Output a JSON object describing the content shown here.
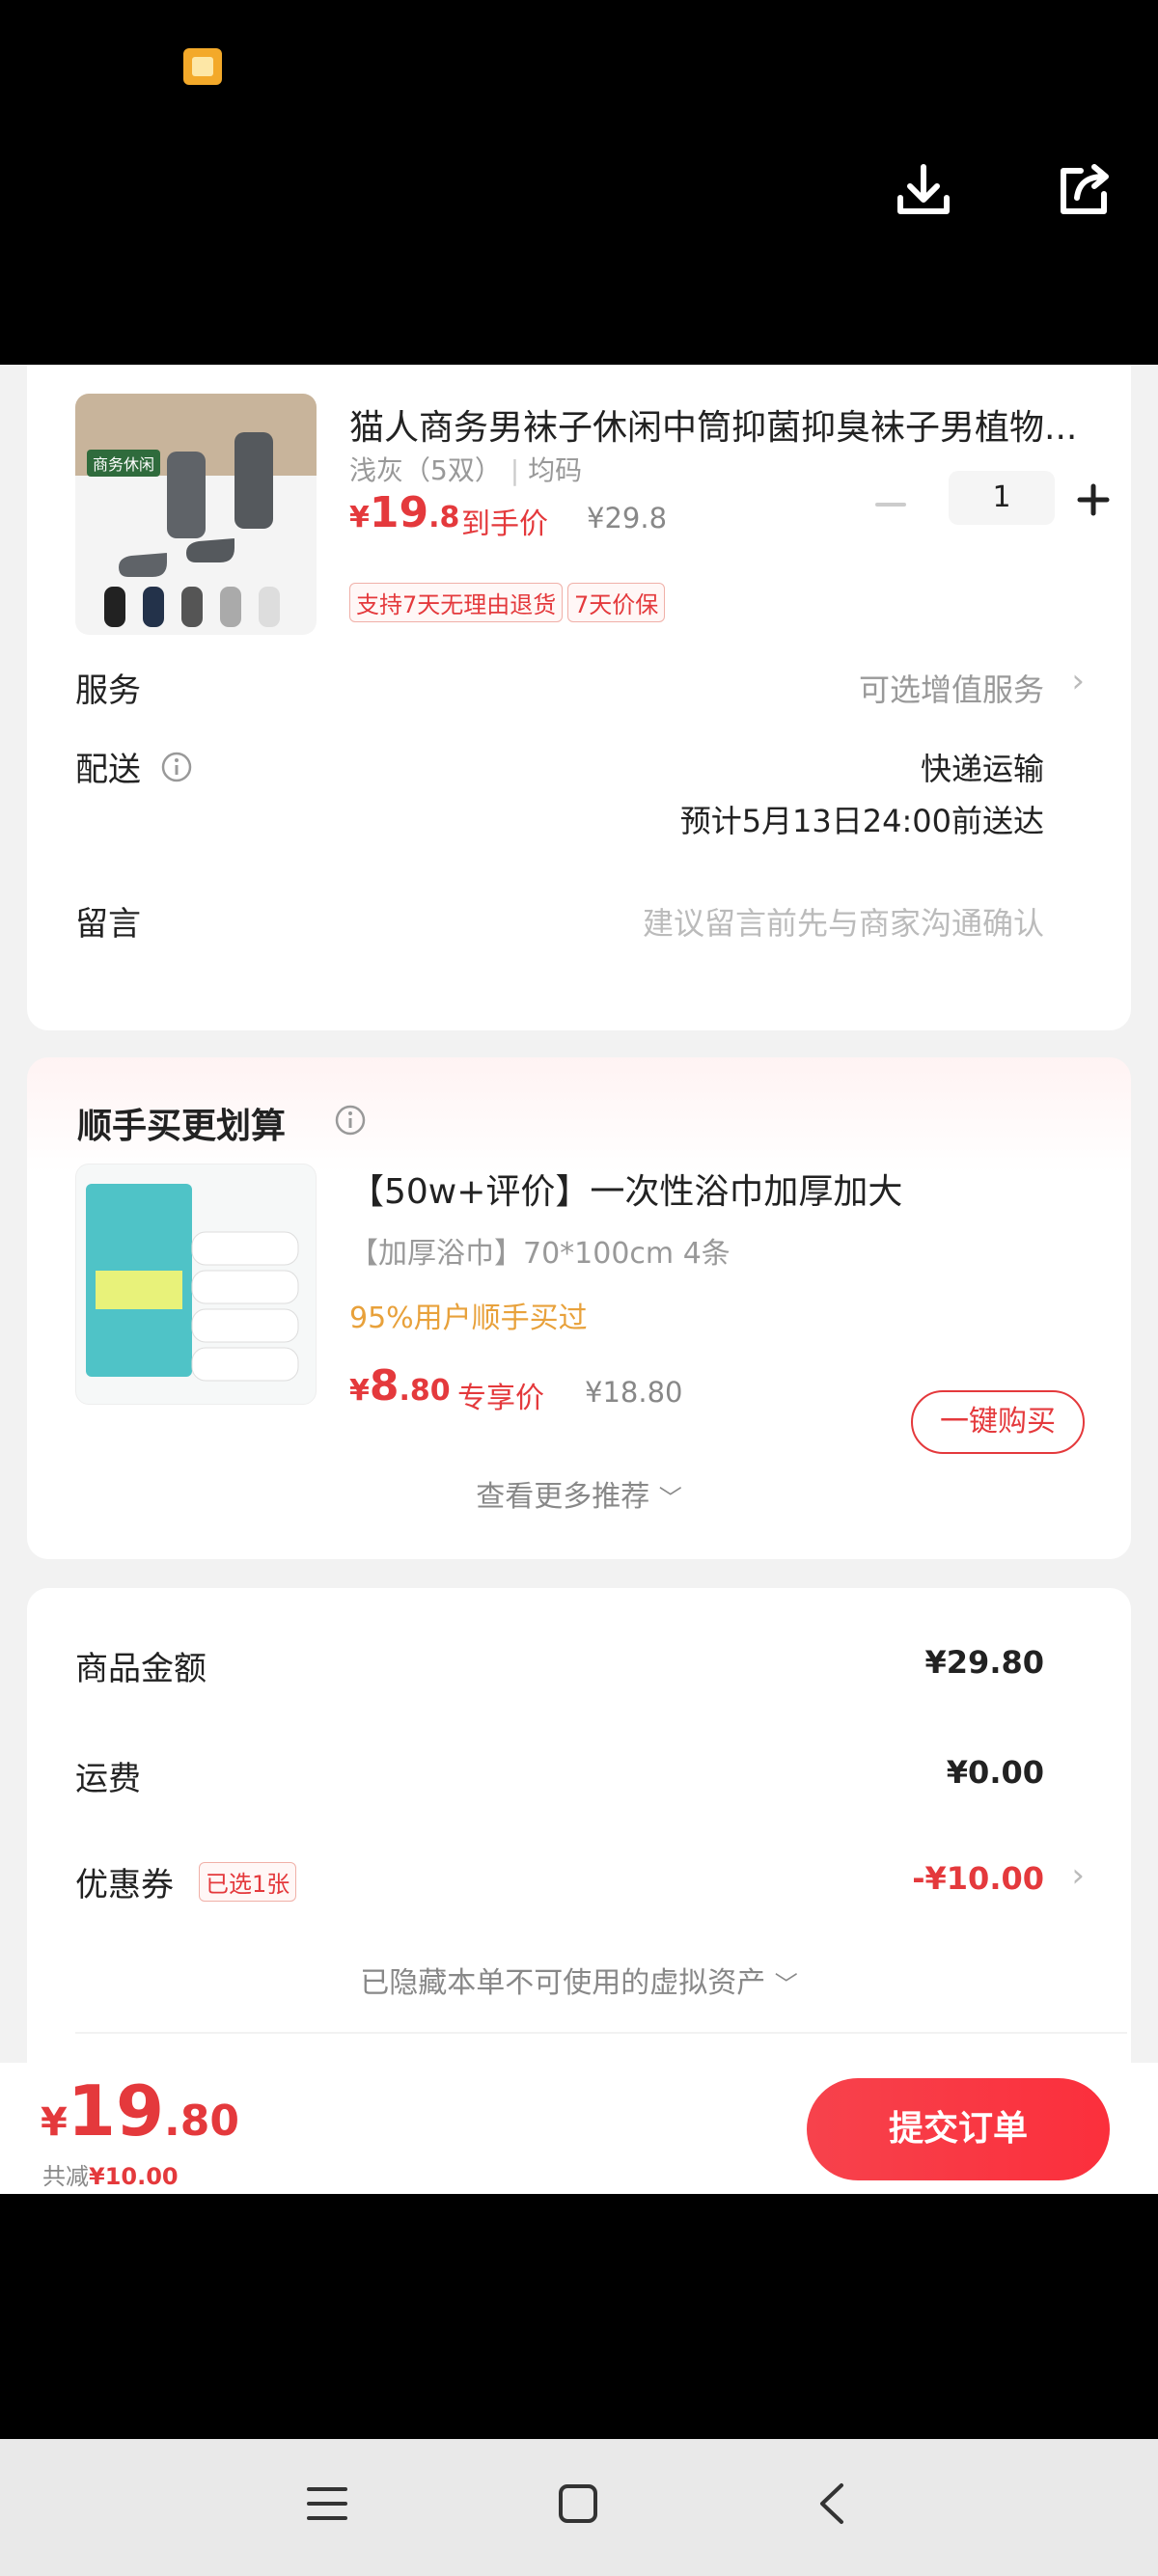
{
  "product": {
    "title": "猫人商务男袜子休闲中筒抑菌抑臭袜子男植物...",
    "variant": "浅灰（5双）",
    "size": "均码",
    "price_symbol": "¥",
    "price_int": "19",
    "price_dec": ".8",
    "price_label": "到手价",
    "original_price": "¥29.8",
    "quantity": "1",
    "tags": [
      "支持7天无理由退货",
      "7天价保"
    ],
    "thumb_badge": "商务休闲"
  },
  "rows": {
    "service_label": "服务",
    "service_value": "可选增值服务",
    "delivery_label": "配送",
    "delivery_method": "快递运输",
    "delivery_eta": "预计5月13日24:00前送达",
    "message_label": "留言",
    "message_placeholder": "建议留言前先与商家沟通确认"
  },
  "recommend": {
    "heading": "顺手买更划算",
    "item_title": "【50w+评价】一次性浴巾加厚加大",
    "item_spec": "【加厚浴巾】70*100cm 4条",
    "item_social": "95%用户顺手买过",
    "price_symbol": "¥",
    "price_int": "8",
    "price_dec": ".80",
    "price_label": "专享价",
    "original_price": "¥18.80",
    "buy_button": "一键购买",
    "more_link": "查看更多推荐"
  },
  "totals": {
    "goods_label": "商品金额",
    "goods_value": "¥29.80",
    "shipping_label": "运费",
    "shipping_value": "¥0.00",
    "coupon_label": "优惠券",
    "coupon_badge": "已选1张",
    "coupon_value": "-¥10.00",
    "hidden_assets": "已隐藏本单不可使用的虚拟资产"
  },
  "bottom": {
    "price_symbol": "¥",
    "price_int": "19",
    "price_dec": ".80",
    "saved_prefix": "共减",
    "saved_value": "¥10.00",
    "submit": "提交订单"
  },
  "colors": {
    "accent_red": "#e4393c",
    "orange_text": "#e8a13b"
  }
}
